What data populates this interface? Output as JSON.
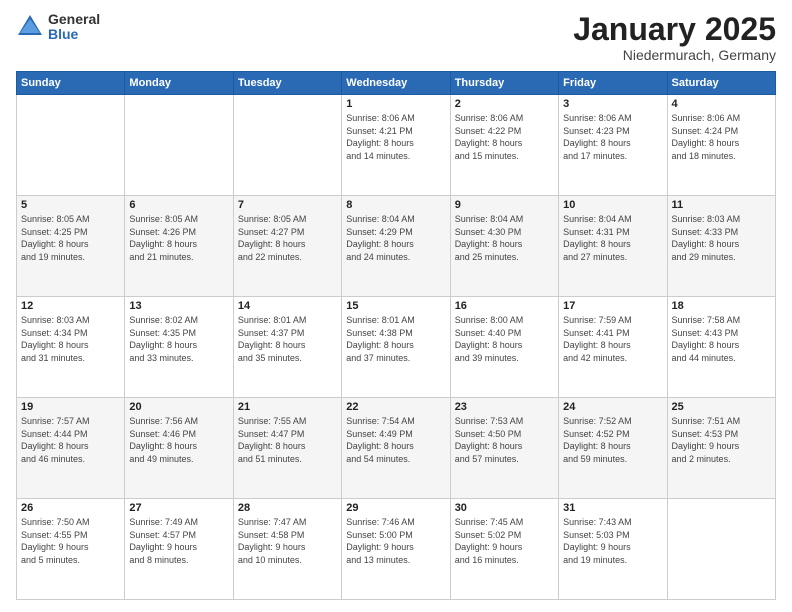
{
  "header": {
    "logo_general": "General",
    "logo_blue": "Blue",
    "title": "January 2025",
    "subtitle": "Niedermurach, Germany"
  },
  "weekdays": [
    "Sunday",
    "Monday",
    "Tuesday",
    "Wednesday",
    "Thursday",
    "Friday",
    "Saturday"
  ],
  "weeks": [
    [
      {
        "day": "",
        "info": ""
      },
      {
        "day": "",
        "info": ""
      },
      {
        "day": "",
        "info": ""
      },
      {
        "day": "1",
        "info": "Sunrise: 8:06 AM\nSunset: 4:21 PM\nDaylight: 8 hours\nand 14 minutes."
      },
      {
        "day": "2",
        "info": "Sunrise: 8:06 AM\nSunset: 4:22 PM\nDaylight: 8 hours\nand 15 minutes."
      },
      {
        "day": "3",
        "info": "Sunrise: 8:06 AM\nSunset: 4:23 PM\nDaylight: 8 hours\nand 17 minutes."
      },
      {
        "day": "4",
        "info": "Sunrise: 8:06 AM\nSunset: 4:24 PM\nDaylight: 8 hours\nand 18 minutes."
      }
    ],
    [
      {
        "day": "5",
        "info": "Sunrise: 8:05 AM\nSunset: 4:25 PM\nDaylight: 8 hours\nand 19 minutes."
      },
      {
        "day": "6",
        "info": "Sunrise: 8:05 AM\nSunset: 4:26 PM\nDaylight: 8 hours\nand 21 minutes."
      },
      {
        "day": "7",
        "info": "Sunrise: 8:05 AM\nSunset: 4:27 PM\nDaylight: 8 hours\nand 22 minutes."
      },
      {
        "day": "8",
        "info": "Sunrise: 8:04 AM\nSunset: 4:29 PM\nDaylight: 8 hours\nand 24 minutes."
      },
      {
        "day": "9",
        "info": "Sunrise: 8:04 AM\nSunset: 4:30 PM\nDaylight: 8 hours\nand 25 minutes."
      },
      {
        "day": "10",
        "info": "Sunrise: 8:04 AM\nSunset: 4:31 PM\nDaylight: 8 hours\nand 27 minutes."
      },
      {
        "day": "11",
        "info": "Sunrise: 8:03 AM\nSunset: 4:33 PM\nDaylight: 8 hours\nand 29 minutes."
      }
    ],
    [
      {
        "day": "12",
        "info": "Sunrise: 8:03 AM\nSunset: 4:34 PM\nDaylight: 8 hours\nand 31 minutes."
      },
      {
        "day": "13",
        "info": "Sunrise: 8:02 AM\nSunset: 4:35 PM\nDaylight: 8 hours\nand 33 minutes."
      },
      {
        "day": "14",
        "info": "Sunrise: 8:01 AM\nSunset: 4:37 PM\nDaylight: 8 hours\nand 35 minutes."
      },
      {
        "day": "15",
        "info": "Sunrise: 8:01 AM\nSunset: 4:38 PM\nDaylight: 8 hours\nand 37 minutes."
      },
      {
        "day": "16",
        "info": "Sunrise: 8:00 AM\nSunset: 4:40 PM\nDaylight: 8 hours\nand 39 minutes."
      },
      {
        "day": "17",
        "info": "Sunrise: 7:59 AM\nSunset: 4:41 PM\nDaylight: 8 hours\nand 42 minutes."
      },
      {
        "day": "18",
        "info": "Sunrise: 7:58 AM\nSunset: 4:43 PM\nDaylight: 8 hours\nand 44 minutes."
      }
    ],
    [
      {
        "day": "19",
        "info": "Sunrise: 7:57 AM\nSunset: 4:44 PM\nDaylight: 8 hours\nand 46 minutes."
      },
      {
        "day": "20",
        "info": "Sunrise: 7:56 AM\nSunset: 4:46 PM\nDaylight: 8 hours\nand 49 minutes."
      },
      {
        "day": "21",
        "info": "Sunrise: 7:55 AM\nSunset: 4:47 PM\nDaylight: 8 hours\nand 51 minutes."
      },
      {
        "day": "22",
        "info": "Sunrise: 7:54 AM\nSunset: 4:49 PM\nDaylight: 8 hours\nand 54 minutes."
      },
      {
        "day": "23",
        "info": "Sunrise: 7:53 AM\nSunset: 4:50 PM\nDaylight: 8 hours\nand 57 minutes."
      },
      {
        "day": "24",
        "info": "Sunrise: 7:52 AM\nSunset: 4:52 PM\nDaylight: 8 hours\nand 59 minutes."
      },
      {
        "day": "25",
        "info": "Sunrise: 7:51 AM\nSunset: 4:53 PM\nDaylight: 9 hours\nand 2 minutes."
      }
    ],
    [
      {
        "day": "26",
        "info": "Sunrise: 7:50 AM\nSunset: 4:55 PM\nDaylight: 9 hours\nand 5 minutes."
      },
      {
        "day": "27",
        "info": "Sunrise: 7:49 AM\nSunset: 4:57 PM\nDaylight: 9 hours\nand 8 minutes."
      },
      {
        "day": "28",
        "info": "Sunrise: 7:47 AM\nSunset: 4:58 PM\nDaylight: 9 hours\nand 10 minutes."
      },
      {
        "day": "29",
        "info": "Sunrise: 7:46 AM\nSunset: 5:00 PM\nDaylight: 9 hours\nand 13 minutes."
      },
      {
        "day": "30",
        "info": "Sunrise: 7:45 AM\nSunset: 5:02 PM\nDaylight: 9 hours\nand 16 minutes."
      },
      {
        "day": "31",
        "info": "Sunrise: 7:43 AM\nSunset: 5:03 PM\nDaylight: 9 hours\nand 19 minutes."
      },
      {
        "day": "",
        "info": ""
      }
    ]
  ]
}
